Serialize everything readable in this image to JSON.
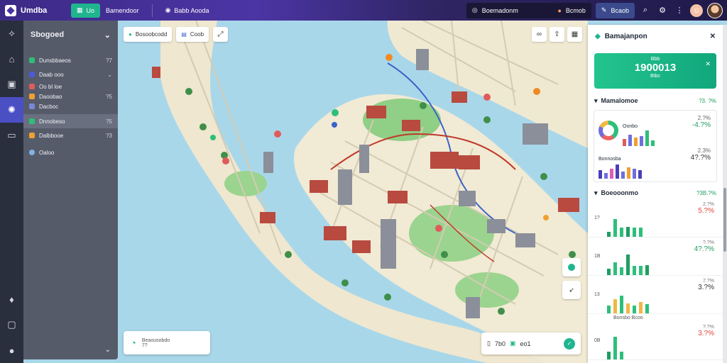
{
  "app": {
    "name": "Umdba"
  },
  "topbar": {
    "tabs": [
      {
        "label": "Uo",
        "active": true
      },
      {
        "label": "Bamendoor"
      },
      {
        "label": "Babb Aooda"
      }
    ],
    "right": {
      "search_label": "Boemadonm",
      "alert_label": "Bcmob",
      "edit_label": "Bcaob"
    }
  },
  "layers": {
    "title": "Sbogoed",
    "items": [
      {
        "label": "Dunsbbaeos",
        "count": "?7",
        "color": "#2dbf7a"
      },
      {
        "label": "Daab ooo",
        "count": "",
        "color": "#4a5bd6"
      },
      {
        "label": "Oo bl loe",
        "count": "",
        "color": "#e05b5b"
      },
      {
        "label": "Daoobao",
        "count": "?5",
        "color": "#f0a030"
      },
      {
        "label": "Dacboc",
        "count": "",
        "color": "#7a86d8"
      },
      {
        "label": "Dnnobeso",
        "count": "?5",
        "color": "#2dbf7a"
      },
      {
        "label": "Dalbbooe",
        "count": "?3",
        "color": "#f0a030"
      },
      {
        "label": "Oaloo",
        "count": "",
        "color": "#7fb3e8"
      }
    ]
  },
  "map": {
    "toolbar": [
      {
        "label": "Bosoobcodd",
        "icon": "leaf-icon"
      },
      {
        "label": "Coob",
        "icon": "layers-icon"
      }
    ],
    "scale_card": {
      "line1": "Beaousobdo",
      "line2": "7?"
    },
    "zoom_card": {
      "a": "7b0",
      "b": "eo1"
    }
  },
  "panel": {
    "title": "Bamajanpon",
    "hero": {
      "kicker": "Bbb",
      "value": "1900013",
      "sub": "Btbc"
    },
    "section1": {
      "title": "Mamalomoe",
      "value": "?3. ?%"
    },
    "card_rows": [
      {
        "label": "Oonbo",
        "a": "2.?%",
        "b": "-4.?%"
      },
      {
        "label": "Bonnosba",
        "a": "2.3%",
        "b": "4?.?%"
      }
    ],
    "section2": {
      "title": "Boeooonmo",
      "value": "?3B.?%"
    },
    "bar_rows": [
      {
        "tick": "1?",
        "a": "2.?%",
        "b": "5.?%",
        "bcolor": "#e0443a",
        "values": [
          0.2,
          0.7,
          0.35,
          0.4,
          0.35,
          0.35
        ]
      },
      {
        "tick": "1B",
        "a": "?.?%",
        "b": "4?.?%",
        "bcolor": "#1e9e5f",
        "values": [
          0.25,
          0.5,
          0.3,
          0.8,
          0.35,
          0.35,
          0.4
        ]
      },
      {
        "tick": "13",
        "a": "7.?%",
        "b": "3.?%",
        "bcolor": "#333",
        "values": [
          0.3,
          0.55,
          0.7,
          0.4,
          0.3,
          0.45,
          0.35
        ]
      },
      {
        "tick": "0B",
        "a": "?.?%",
        "b": "3.?%",
        "bcolor": "#e0443a",
        "values": [
          0.3,
          0.9,
          0.3
        ]
      }
    ],
    "subhead": "Bonsbo Bcoo"
  }
}
